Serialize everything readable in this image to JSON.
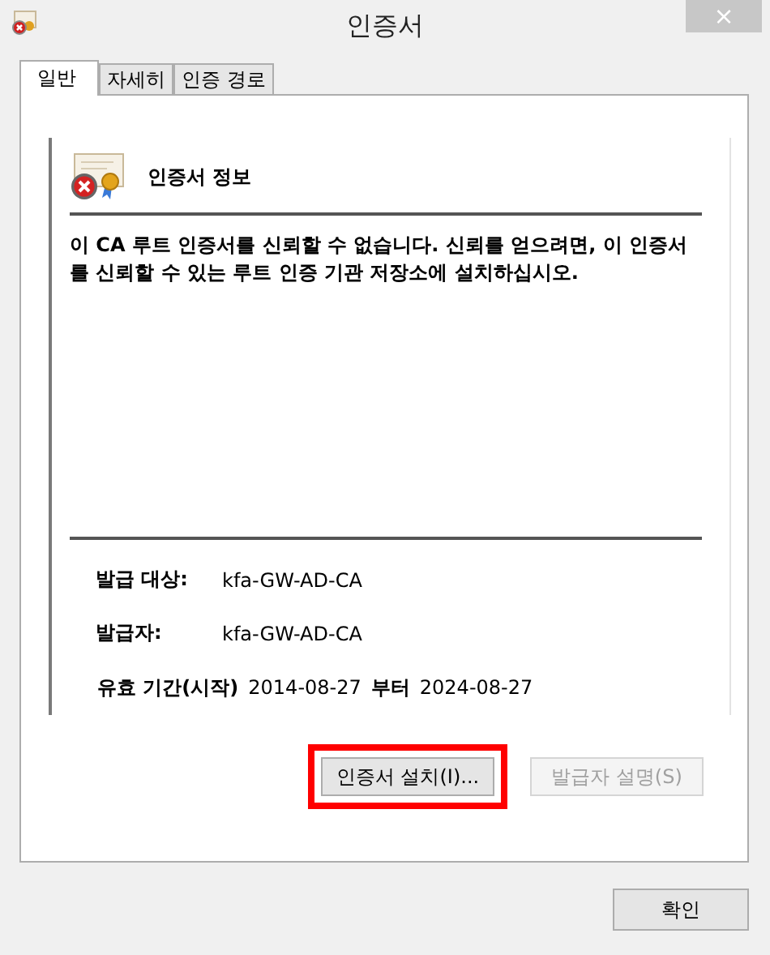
{
  "window": {
    "title": "인증서",
    "close": "×"
  },
  "tabs": [
    {
      "label": "일반",
      "selected": true
    },
    {
      "label": "자세히",
      "selected": false
    },
    {
      "label": "인증 경로",
      "selected": false
    }
  ],
  "info": {
    "heading": "인증서 정보",
    "message": "이 CA 루트 인증서를 신뢰할 수 없습니다. 신뢰를 얻으려면, 이 인증서를 신뢰할 수 있는 루트 인증 기관 저장소에 설치하십시오.",
    "issued_to": {
      "label": "발급 대상:",
      "value": "kfa-GW-AD-CA"
    },
    "issued_by": {
      "label": "발급자:",
      "value": "kfa-GW-AD-CA"
    },
    "validity": {
      "label": "유효 기간(시작)",
      "from": "2014-08-27",
      "to_label": "부터",
      "to": "2024-08-27"
    }
  },
  "actions": [
    {
      "label": "인증서 설치(I)...",
      "disabled": false,
      "highlighted": true
    },
    {
      "label": "발급자 설명(S)",
      "disabled": true,
      "highlighted": false
    }
  ],
  "ok_button": "확인"
}
